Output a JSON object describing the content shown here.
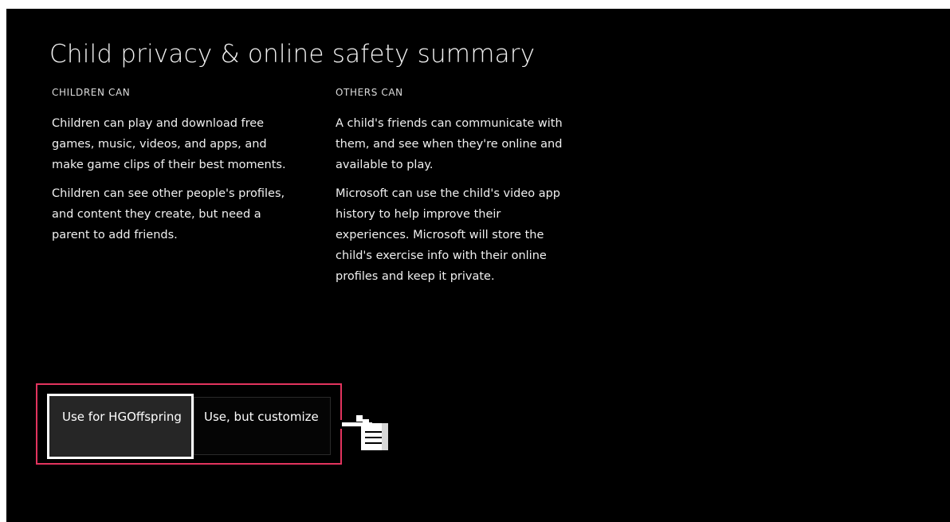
{
  "page": {
    "title": "Child privacy & online safety summary"
  },
  "children_can": {
    "heading": "CHILDREN CAN",
    "paragraphs": [
      "Children can play and download free games, music, videos, and apps, and make game clips of their best moments.",
      "Children can see other people's profiles, and content they create, but need a parent to add friends."
    ]
  },
  "others_can": {
    "heading": "OTHERS CAN",
    "paragraphs": [
      "A child's friends can communicate with them, and see when they're online and available to play.",
      "Microsoft can use the child's video app history to help improve their experiences. Microsoft will store the child's exercise info with their online profiles and keep it private."
    ]
  },
  "options": {
    "use_for": "Use for HGOffspring",
    "use_customize": "Use, but customize"
  },
  "icons": {
    "cursor": "hand-pointer-icon"
  },
  "colors": {
    "background": "#000000",
    "highlight_border": "#e2345e",
    "selected_option_bg": "#262626",
    "text": "#ffffff"
  }
}
